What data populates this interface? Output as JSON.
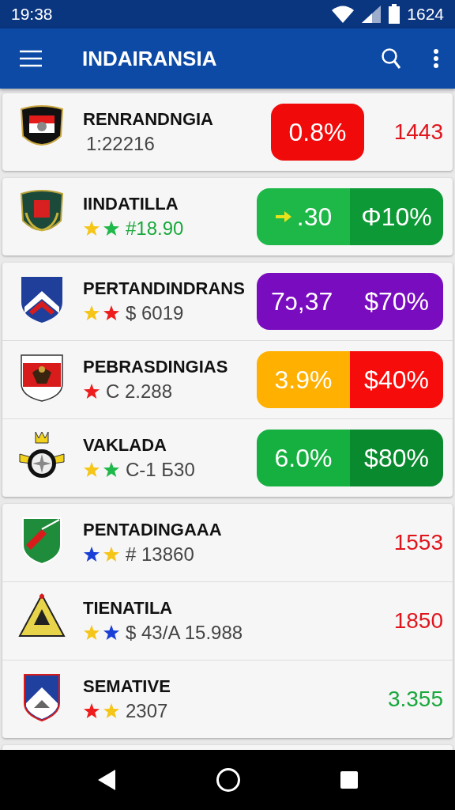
{
  "status_bar": {
    "time": "19:38",
    "battery_text": "1624"
  },
  "app_bar": {
    "title": "INDAIRANSIA"
  },
  "cards": [
    {
      "kind": "list",
      "rows": [
        {
          "emblem": {
            "kind": "crest"
          },
          "name": "RENRANDNGIA",
          "sub": {
            "text": "1:22216",
            "color": "#444444"
          },
          "right": {
            "kind": "pill_value",
            "segments": [
              {
                "texts": [
                  "0.8%"
                ],
                "color": "#f00a0a"
              }
            ],
            "value": "1443",
            "color": "#e0141c"
          }
        }
      ]
    },
    {
      "kind": "list",
      "rows": [
        {
          "emblem": {
            "kind": "wreath"
          },
          "name": "IINDATILLA",
          "sub": {
            "stars": [
              {
                "color": "#f5c518"
              },
              {
                "color": "#1fb84a"
              }
            ],
            "text": "#18.90",
            "color": "#17a83a"
          },
          "right": {
            "kind": "split",
            "segments": [
              {
                "texts": [
                  ".30"
                ],
                "arrow": true,
                "color": "#1db848"
              },
              {
                "texts": [
                  "Φ10%"
                ],
                "color": "#0d9a36"
              }
            ]
          }
        }
      ]
    },
    {
      "kind": "list",
      "rows": [
        {
          "emblem": {
            "kind": "chevron"
          },
          "name": "PERTANDINDRANS",
          "sub": {
            "stars": [
              {
                "color": "#f5c518"
              },
              {
                "color": "#ee1c1c"
              }
            ],
            "text": "$ 6019",
            "color": "#444444"
          },
          "right": {
            "kind": "solid",
            "segments": [
              {
                "texts": [
                  "7ɔ,37",
                  "$70%"
                ],
                "color": "#7a0cbf"
              }
            ]
          }
        },
        {
          "emblem": {
            "kind": "eagle"
          },
          "name": "PEBRASDINGIAS",
          "sub": {
            "stars": [
              {
                "color": "#ee1c1c"
              }
            ],
            "text": "C 2.288",
            "color": "#444444"
          },
          "right": {
            "kind": "split",
            "segments": [
              {
                "texts": [
                  "3.9%"
                ],
                "color": "#ffb000"
              },
              {
                "texts": [
                  "$40%"
                ],
                "color": "#f70c0c"
              }
            ]
          }
        },
        {
          "emblem": {
            "kind": "compass"
          },
          "name": "VAKLADA",
          "sub": {
            "stars": [
              {
                "color": "#f5c518"
              },
              {
                "color": "#1fb84a"
              }
            ],
            "text": "C-1 Б30",
            "color": "#444444"
          },
          "right": {
            "kind": "split",
            "segments": [
              {
                "texts": [
                  "6.0%"
                ],
                "color": "#16b040"
              },
              {
                "texts": [
                  "$80%"
                ],
                "color": "#0a8a2e"
              }
            ]
          }
        }
      ]
    },
    {
      "kind": "list",
      "rows": [
        {
          "emblem": {
            "kind": "pennant"
          },
          "name": "PENTADINGAAA",
          "sub": {
            "stars": [
              {
                "color": "#1a3fd6"
              },
              {
                "color": "#f5c518"
              }
            ],
            "text": "# 13860",
            "color": "#444444"
          },
          "right": {
            "kind": "value",
            "value": "1553",
            "color": "#e0141c"
          }
        },
        {
          "emblem": {
            "kind": "pyramid"
          },
          "name": "TIENATILA",
          "sub": {
            "stars": [
              {
                "color": "#f5c518"
              },
              {
                "color": "#1a3fd6"
              }
            ],
            "text": "$ 43/A 15.988",
            "color": "#444444"
          },
          "right": {
            "kind": "value",
            "value": "1850",
            "color": "#e0141c"
          }
        },
        {
          "emblem": {
            "kind": "mountain"
          },
          "name": "SEMATIVE",
          "sub": {
            "stars": [
              {
                "color": "#ee1c1c"
              },
              {
                "color": "#f5c518"
              }
            ],
            "text": "2307",
            "color": "#444444"
          },
          "right": {
            "kind": "value",
            "value": "3.355",
            "color": "#18a83c"
          }
        }
      ]
    },
    {
      "kind": "cut"
    }
  ]
}
